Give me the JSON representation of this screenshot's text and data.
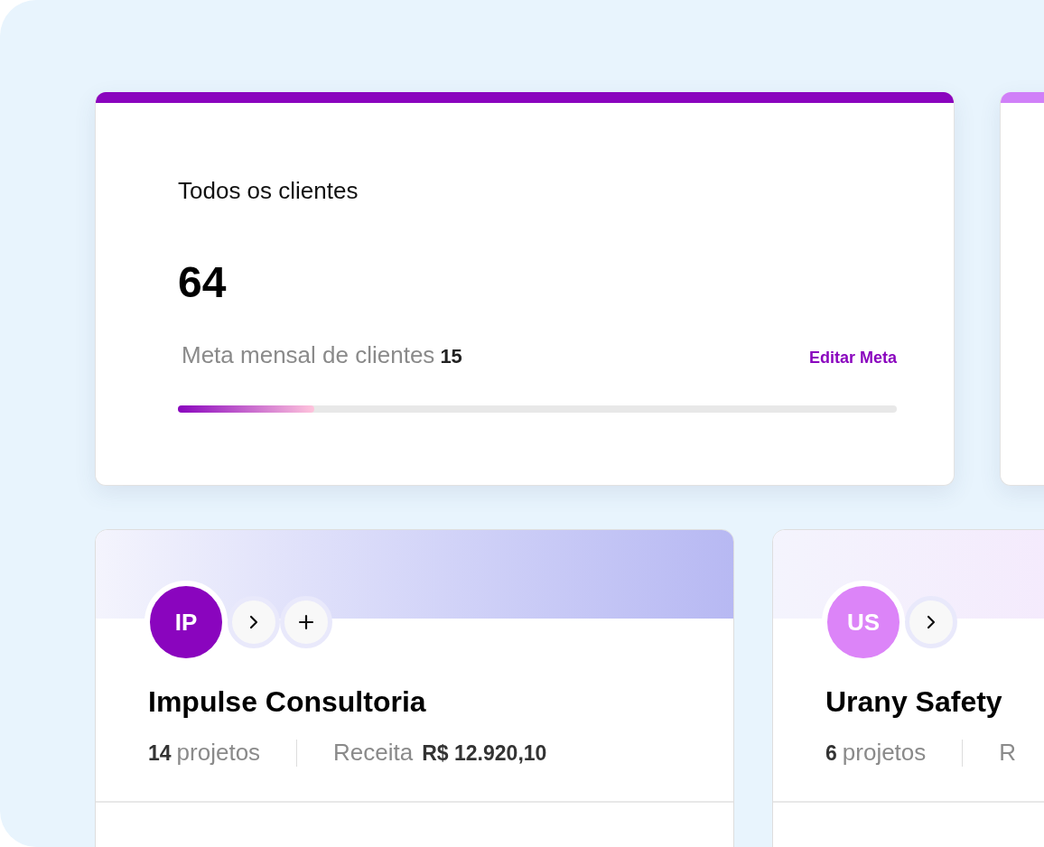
{
  "stat_cards": [
    {
      "title": "Todos os clientes",
      "value": "64",
      "goal_label": "Meta mensal de clientes",
      "goal_value": "15",
      "action": "Editar Meta",
      "level": 0.19,
      "color": "#8a05be"
    },
    {
      "color": "#d080f8"
    }
  ],
  "clients": [
    {
      "initials": "IP",
      "color": "#8a05be",
      "name": "Impulse Consultoria",
      "projects_count": "14",
      "projects_label": "projetos",
      "revenue_label": "Receita",
      "revenue_value": "R$ 12.920,10",
      "actions": [
        {
          "kind": "open"
        },
        {
          "kind": "add"
        }
      ]
    },
    {
      "initials": "US",
      "color": "#dc84f8",
      "name": "Urany Safety",
      "projects_count": "6",
      "projects_label": "projetos",
      "revenue_label": "R",
      "actions": [
        {
          "kind": "open"
        }
      ]
    }
  ]
}
